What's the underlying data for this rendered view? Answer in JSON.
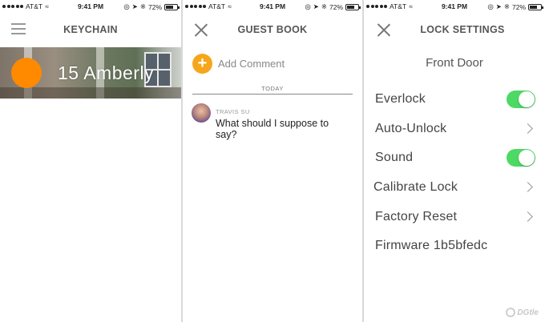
{
  "status_bar": {
    "carrier": "AT&T",
    "time": "9:41 PM",
    "battery": "72%",
    "battery_level": 0.72
  },
  "keychain": {
    "title": "KEYCHAIN",
    "lock_name": "15 Amberly",
    "accent_color": "#ff8a00"
  },
  "guest_book": {
    "title": "GUEST BOOK",
    "add_comment_label": "Add Comment",
    "divider_label": "TODAY",
    "comments": [
      {
        "author": "TRAVIS SU",
        "text": "What should I suppose to say?"
      }
    ],
    "accent_color": "#f6a61c"
  },
  "lock_settings": {
    "title": "LOCK SETTINGS",
    "door_name": "Front Door",
    "items": [
      {
        "label": "Everlock",
        "control": "toggle",
        "on": true
      },
      {
        "label": "Auto-Unlock",
        "control": "chevron"
      },
      {
        "label": "Sound",
        "control": "toggle",
        "on": true
      },
      {
        "label": "Calibrate Lock",
        "control": "chevron"
      },
      {
        "label": "Factory Reset",
        "control": "chevron"
      },
      {
        "label": "Firmware 1b5bfedc",
        "control": "none"
      }
    ],
    "toggle_color": "#4cd964"
  },
  "watermark": {
    "text": "DGtle"
  },
  "icons": {
    "menu": "hamburger-icon",
    "close": "close-icon",
    "add": "plus-icon",
    "chevron": "chevron-right-icon"
  }
}
